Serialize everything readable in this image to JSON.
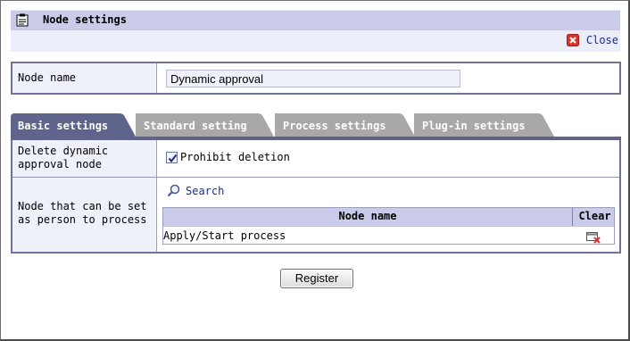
{
  "header": {
    "title": "Node settings",
    "close_label": "Close",
    "title_icon": "clipboard-icon",
    "close_icon": "close-x-icon"
  },
  "node_name": {
    "label": "Node name",
    "value": "Dynamic approval"
  },
  "tabs": [
    {
      "label": "Basic settings",
      "active": true
    },
    {
      "label": "Standard setting",
      "active": false
    },
    {
      "label": "Process settings",
      "active": false
    },
    {
      "label": "Plug-in settings",
      "active": false
    }
  ],
  "basic": {
    "delete_label": "Delete dynamic approval node",
    "delete_checkbox_label": "Prohibit deletion",
    "delete_checked": true,
    "process_label": "Node that can be set as person to process",
    "search_label": "Search",
    "table": {
      "headers": [
        "Node name",
        "Clear"
      ],
      "rows": [
        {
          "name": "Apply/Start process"
        }
      ]
    }
  },
  "footer": {
    "register_label": "Register"
  },
  "colors": {
    "active_tab": "#5f648c",
    "inactive_tab": "#a8a8a8",
    "title_bar": "#c9cbe8",
    "link": "#1a2a8a"
  }
}
